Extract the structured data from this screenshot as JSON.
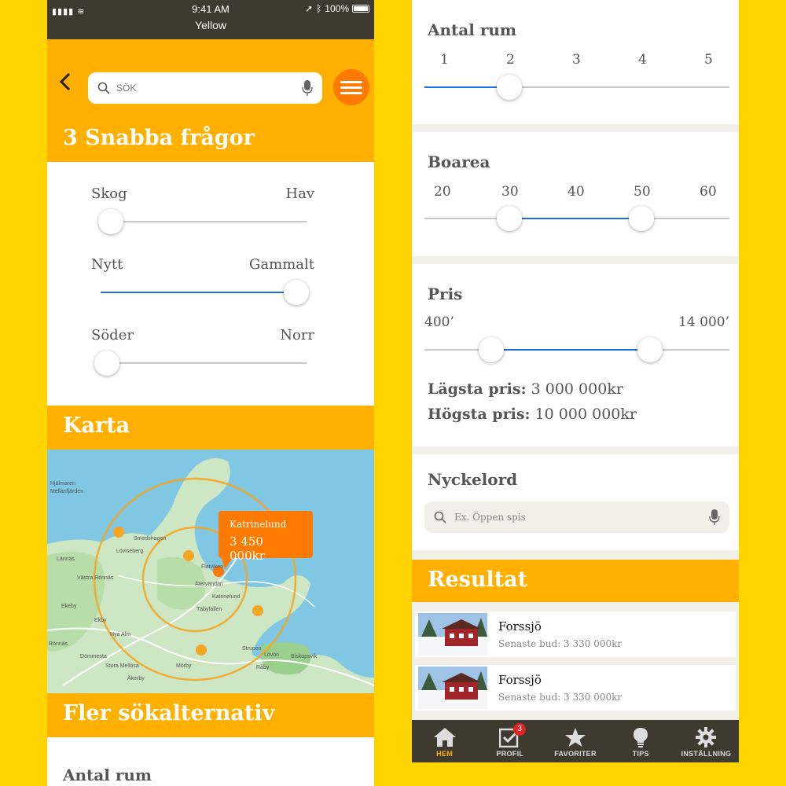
{
  "status": {
    "time": "9:41 AM",
    "app_name": "Yellow",
    "battery": "100%"
  },
  "search": {
    "placeholder": "SÖK"
  },
  "quick": {
    "title": "3 Snabba frågor",
    "sliders": [
      {
        "left": "Skog",
        "right": "Hav",
        "value": 0.05
      },
      {
        "left": "Nytt",
        "right": "Gammalt",
        "value": 0.95
      },
      {
        "left": "Söder",
        "right": "Norr",
        "value": 0.03
      }
    ]
  },
  "map": {
    "title": "Karta",
    "tooltip_name": "Katrinelund",
    "tooltip_price": "3 450 000kr",
    "labels": [
      "Hjälmaren",
      "Mellanfjärden",
      "Smedshagen",
      "Löviseberg",
      "Flatviken",
      "Ätervändan",
      "Katrinelund",
      "Täbyfallen",
      "Lännäs",
      "Västra Rönnäs",
      "Ekeby",
      "Ekby",
      "Hya Alm",
      "Rönnäs",
      "Dömmesta",
      "Stora Mellösa",
      "Åkerby",
      "Mörby",
      "Strupen",
      "Lövön",
      "Biskopsvik",
      "Råby"
    ]
  },
  "more": {
    "title": "Fler sökalternativ",
    "rooms_title": "Antal rum"
  },
  "rooms": {
    "title": "Antal rum",
    "ticks": [
      "1",
      "2",
      "3",
      "4",
      "5"
    ],
    "value": 2
  },
  "area": {
    "title": "Boarea",
    "ticks": [
      "20",
      "30",
      "40",
      "50",
      "60"
    ],
    "min": 30,
    "max": 50
  },
  "price": {
    "title": "Pris",
    "min_label": "400’",
    "max_label": "14 000’",
    "min_fraction": 0.22,
    "max_fraction": 0.74,
    "lowest_label": "Lägsta pris:",
    "lowest_value": "3 000 000kr",
    "highest_label": "Högsta pris:",
    "highest_value": "10 000 000kr"
  },
  "keywords": {
    "title": "Nyckelord",
    "placeholder": "Ex. Öppen spis"
  },
  "results": {
    "title": "Resultat",
    "items": [
      {
        "name": "Forssjö",
        "sub": "Senaste bud: 3 330 000kr"
      },
      {
        "name": "Forssjö",
        "sub": "Senaste bud: 3 330 000kr"
      }
    ]
  },
  "tabs": [
    {
      "label": "HEM",
      "icon": "home-icon",
      "active": true
    },
    {
      "label": "PROFIL",
      "icon": "checkbox-icon",
      "badge": "3"
    },
    {
      "label": "FAVORITER",
      "icon": "star-icon"
    },
    {
      "label": "TIPS",
      "icon": "lightbulb-icon"
    },
    {
      "label": "INSTÄLLNING",
      "icon": "gear-icon"
    }
  ],
  "colors": {
    "accent": "#FFB000",
    "orange": "#FF7A00",
    "slider_fill": "#1E6FD9",
    "background": "#FFD400",
    "dark": "#3E3A30"
  }
}
